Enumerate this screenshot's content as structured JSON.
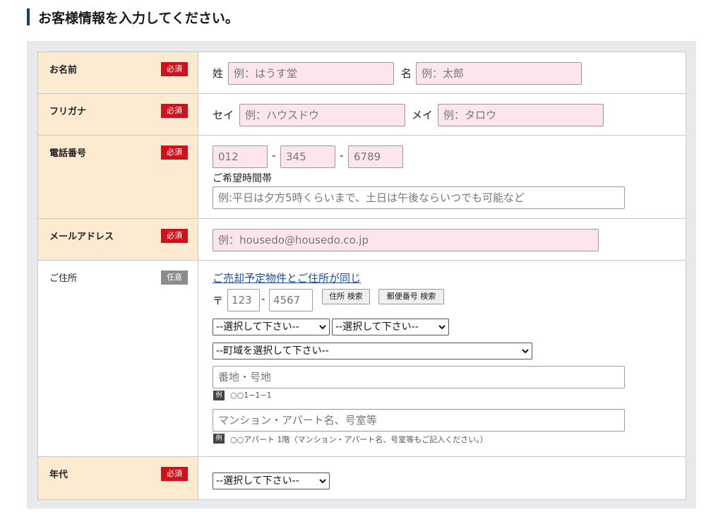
{
  "heading": "お客様情報を入力してください。",
  "badges": {
    "required": "必須",
    "optional": "任意"
  },
  "name_row": {
    "label": "お名前",
    "last_label": "姓",
    "last_placeholder": "例：はうす堂",
    "first_label": "名",
    "first_placeholder": "例：太郎"
  },
  "kana_row": {
    "label": "フリガナ",
    "last_label": "セイ",
    "last_placeholder": "例：ハウスドウ",
    "first_label": "メイ",
    "first_placeholder": "例：タロウ"
  },
  "phone_row": {
    "label": "電話番号",
    "part1": "012",
    "part2": "345",
    "part3": "6789",
    "separator": "-",
    "time_label": "ご希望時間帯",
    "time_placeholder": "例:平日は夕方5時くらいまで、土日は午後ならいつでも可能など"
  },
  "email_row": {
    "label": "メールアドレス",
    "placeholder": "例：housedo@housedo.co.jp"
  },
  "address_row": {
    "label": "ご住所",
    "same_link": "ご売却予定物件とご住所が同じ",
    "postal_mark": "〒",
    "postal1": "123",
    "postal2": "4567",
    "separator": "-",
    "address_search_btn": "住所 検索",
    "postal_search_btn": "郵便番号 検索",
    "prefecture_select": "--選択して下さい--",
    "city_select": "--選択して下さい--",
    "town_select": "--町域を選択して下さい--",
    "street_placeholder": "番地・号地",
    "street_example_badge": "例",
    "street_example": "○○1−1−1",
    "building_placeholder": "マンション・アパート名、号室等",
    "building_example_badge": "例",
    "building_example": "○○アパート 1階（マンション・アパート名、号室等もご記入ください。）"
  },
  "age_row": {
    "label": "年代",
    "select": "--選択して下さい--"
  },
  "colors": {
    "required_bg": "#fcebd1",
    "required_badge": "#d0101b",
    "input_pink": "#fce5ee",
    "link": "#1a4f9c"
  }
}
